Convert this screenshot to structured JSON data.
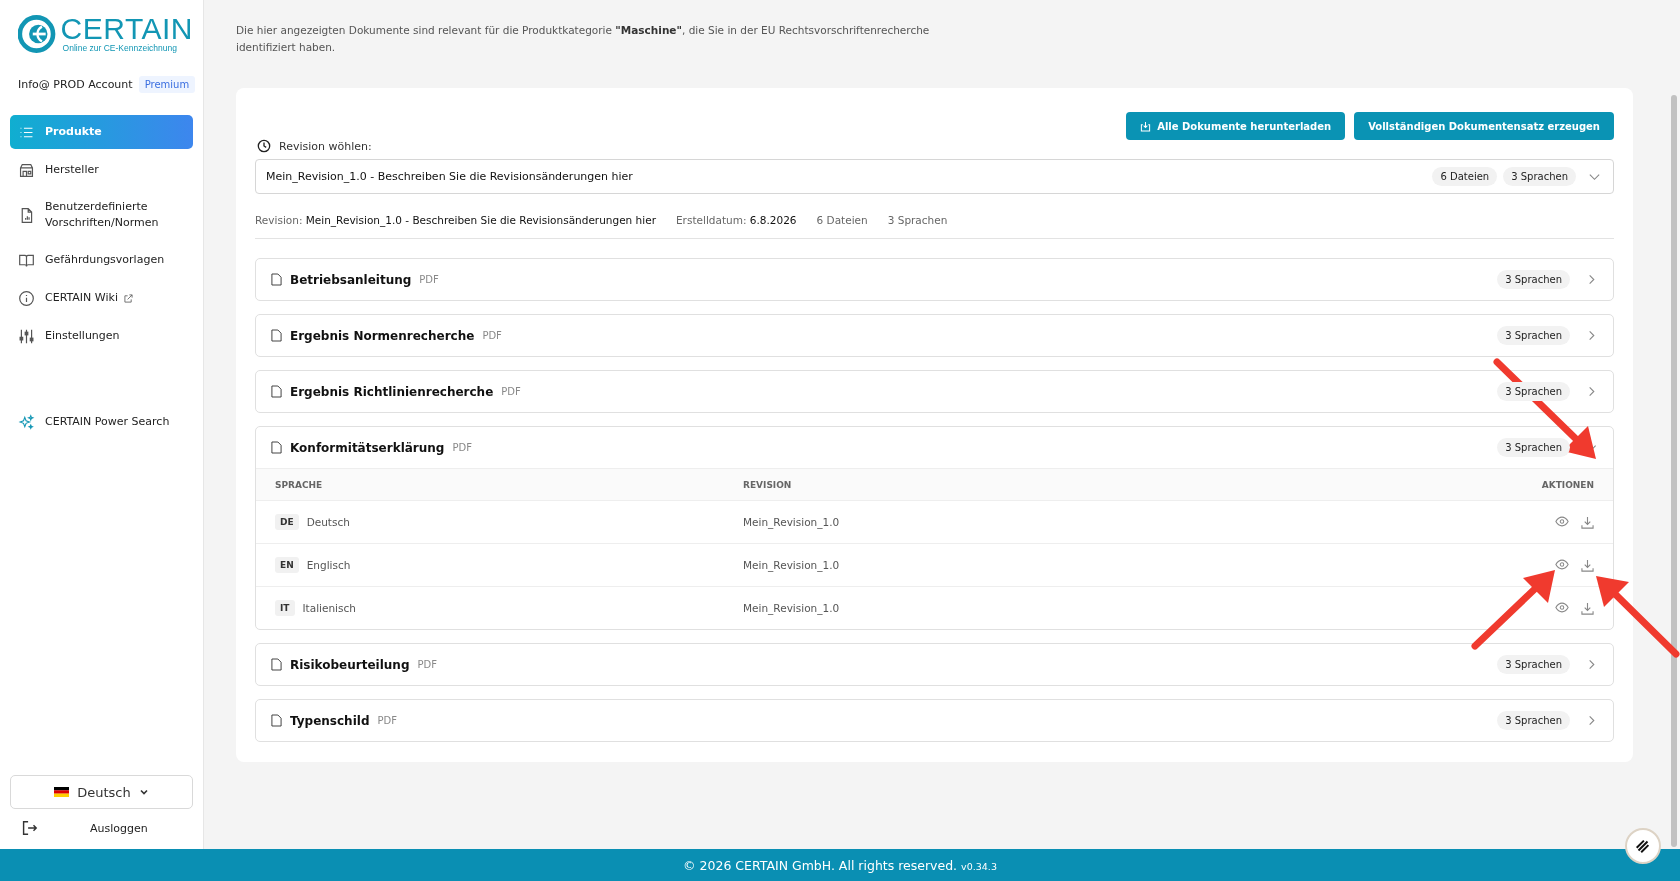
{
  "logo": {
    "name": "CERTAIN",
    "tagline": "Online zur CE-Kennzeichnung"
  },
  "account": {
    "name": "Info@ PROD Account",
    "badge": "Premium"
  },
  "nav": [
    {
      "label": "Produkte",
      "selected": true,
      "external": false
    },
    {
      "label": "Hersteller",
      "selected": false,
      "external": false
    },
    {
      "label": "Benutzerdefinierte Vorschriften/Normen",
      "selected": false,
      "external": false
    },
    {
      "label": "Gefährdungsvorlagen",
      "selected": false,
      "external": false
    },
    {
      "label": "CERTAIN Wiki",
      "selected": false,
      "external": true
    },
    {
      "label": "Einstellungen",
      "selected": false,
      "external": false
    }
  ],
  "power_search": {
    "label": "CERTAIN Power Search"
  },
  "language": {
    "value": "Deutsch"
  },
  "logout": {
    "label": "Ausloggen"
  },
  "intro": "Die hier angezeigten Dokumente sind relevant für die Produktkategorie **\"Maschine\"**, die Sie in der EU Rechtsvorschriftenrecherche identifiziert haben.",
  "actions": [
    {
      "label": "Alle Dokumente herunterladen",
      "kind": "download"
    },
    {
      "label": "Vollständigen Dokumentensatz erzeugen",
      "kind": "plain"
    }
  ],
  "revision": {
    "label": "Revision wöhlen:",
    "value": "Mein_Revision_1.0 - Beschreiben Sie die Revisionsänderungen hier",
    "files": "6 Dateien",
    "languages": "3 Sprachen"
  },
  "meta": {
    "revision_label": "Revision:",
    "revision": "Mein_Revision_1.0 - Beschreiben Sie die Revisionsänderungen hier",
    "date_label": "Erstelldatum:",
    "date": "6.8.2026",
    "files": "6 Dateien",
    "languages": "3 Sprachen"
  },
  "documents": [
    {
      "title": "Betriebsanleitung",
      "format": "PDF",
      "languages": "3 Sprachen",
      "expanded": false
    },
    {
      "title": "Ergebnis Normenrecherche",
      "format": "PDF",
      "languages": "3 Sprachen",
      "expanded": false
    },
    {
      "title": "Ergebnis Richtlinienrecherche",
      "format": "PDF",
      "languages": "3 Sprachen",
      "expanded": false
    },
    {
      "title": "Konformitätserklärung",
      "format": "PDF",
      "languages": "3 Sprachen",
      "expanded": true,
      "table": {
        "columns": [
          "SPRACHE",
          "REVISION",
          "AKTIONEN"
        ],
        "rows": [
          {
            "code": "DE",
            "language": "Deutsch",
            "revision": "Mein_Revision_1.0"
          },
          {
            "code": "EN",
            "language": "Englisch",
            "revision": "Mein_Revision_1.0"
          },
          {
            "code": "IT",
            "language": "Italienisch",
            "revision": "Mein_Revision_1.0"
          }
        ]
      }
    },
    {
      "title": "Risikobeurteilung",
      "format": "PDF",
      "languages": "3 Sprachen",
      "expanded": false
    },
    {
      "title": "Typenschild",
      "format": "PDF",
      "languages": "3 Sprachen",
      "expanded": false
    }
  ],
  "footer": {
    "text": "© 2026 CERTAIN GmbH. All rights reserved.",
    "version": "v0.34.3"
  }
}
